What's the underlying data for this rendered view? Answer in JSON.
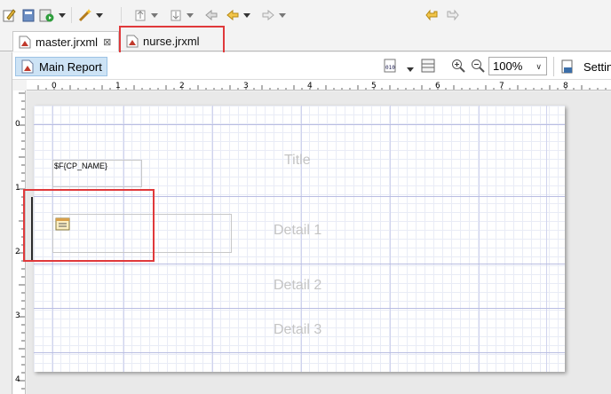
{
  "tabs": [
    {
      "label": "master.jrxml",
      "active": true
    },
    {
      "label": "nurse.jrxml",
      "active": false
    }
  ],
  "editor": {
    "main_report_label": "Main Report",
    "zoom_value": "100%",
    "settings_label": "Settin"
  },
  "ruler": {
    "h_ticks": [
      "0",
      "1",
      "2",
      "3",
      "4",
      "5",
      "6",
      "7",
      "8"
    ],
    "v_ticks": [
      "0",
      "1",
      "2",
      "3",
      "4"
    ]
  },
  "report": {
    "field_expression": "$F{CP_NAME}",
    "bands": [
      "Title",
      "Detail 1",
      "Detail 2",
      "Detail 3"
    ]
  },
  "colors": {
    "highlight": "#e0393b",
    "selection": "#cde3f5",
    "band_line": "#b9bde2",
    "band_label": "#c4c4c4"
  },
  "icons": [
    "edit-icon",
    "db-icon",
    "run-icon",
    "wand-icon",
    "up-icon",
    "down-icon",
    "back-icon",
    "prev-icon",
    "next-icon",
    "undo-icon",
    "redo-icon",
    "jrxml-file-icon",
    "close-icon",
    "report-icon",
    "datasource-icon",
    "layout-icon",
    "zoom-in-icon",
    "zoom-out-icon",
    "settings-icon",
    "subreport-icon"
  ]
}
